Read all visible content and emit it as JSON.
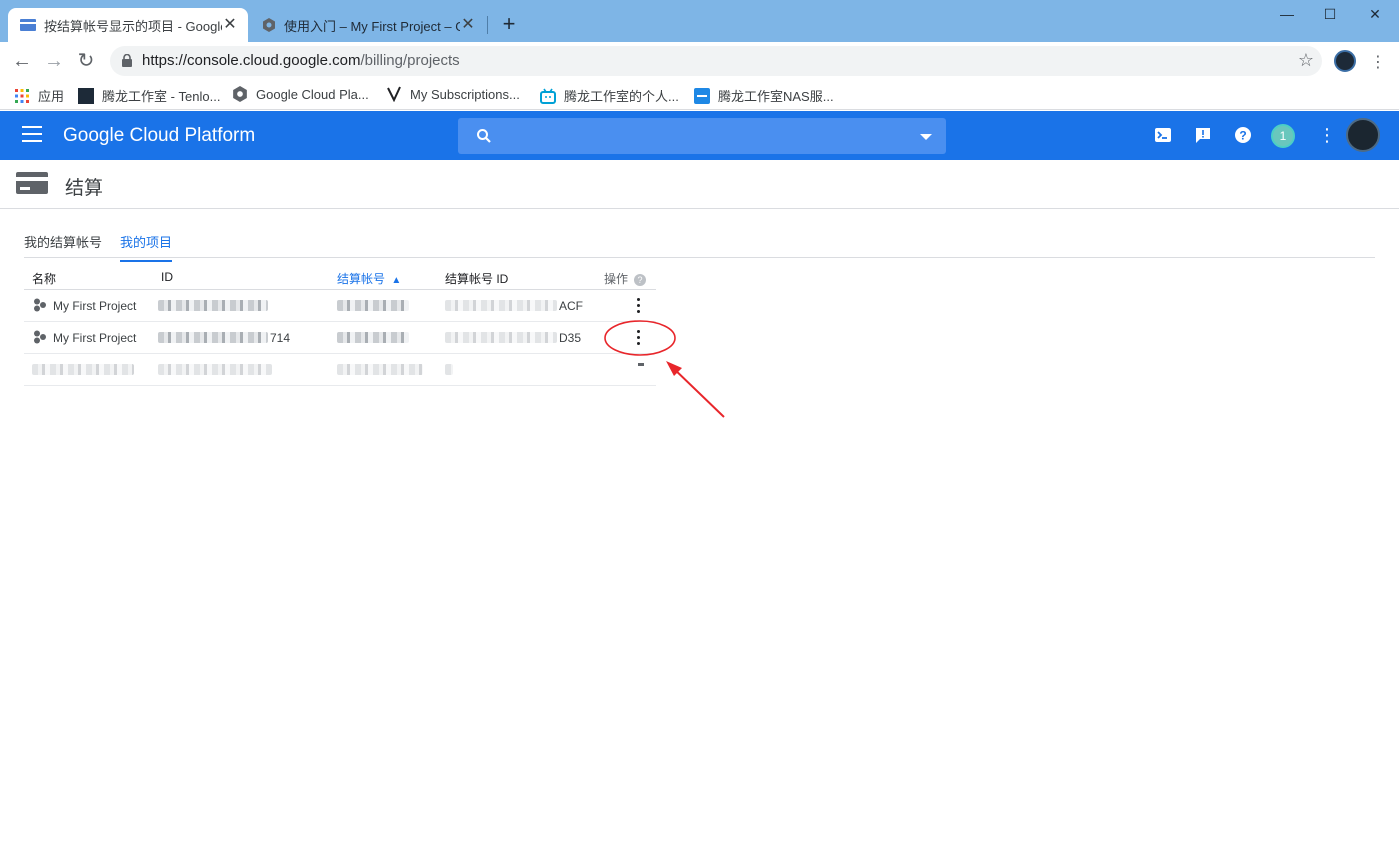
{
  "browser": {
    "tabs": [
      {
        "title": "按结算帐号显示的项目 - Google",
        "active": true
      },
      {
        "title": "使用入门 – My First Project – G",
        "active": false
      }
    ],
    "url_main": "https://console.cloud.google.com",
    "url_path": "/billing/projects",
    "bookmarks": [
      {
        "label": "应用",
        "icon": "apps-grid-icon"
      },
      {
        "label": "腾龙工作室 - Tenlo...",
        "icon": "site-logo-icon"
      },
      {
        "label": "Google Cloud Pla...",
        "icon": "gcp-hex-icon"
      },
      {
        "label": "My Subscriptions...",
        "icon": "v-logo-icon"
      },
      {
        "label": "腾龙工作室的个人...",
        "icon": "bilibili-icon"
      },
      {
        "label": "腾龙工作室NAS服...",
        "icon": "dsm-icon"
      }
    ]
  },
  "gcp": {
    "title": "Google Cloud Platform",
    "notification_count": "1"
  },
  "page": {
    "title": "结算",
    "tabs": [
      {
        "label": "我的结算帐号",
        "active": false
      },
      {
        "label": "我的项目",
        "active": true
      }
    ]
  },
  "table": {
    "headers": {
      "name": "名称",
      "id": "ID",
      "billing_account": "结算帐号",
      "billing_account_id": "结算帐号 ID",
      "actions": "操作"
    },
    "sort_indicator": "^",
    "rows": [
      {
        "name": "My First Project",
        "id_suffix": "",
        "account_id_suffix": "ACF"
      },
      {
        "name": "My First Project",
        "id_suffix": "714",
        "account_id_suffix": "D35"
      },
      {
        "name": "",
        "id_suffix": "",
        "account_id_suffix": ""
      }
    ]
  },
  "colors": {
    "gcp_blue": "#1a73e8",
    "tabstrip": "#7eb5e6",
    "annotation_red": "#e8262b"
  }
}
